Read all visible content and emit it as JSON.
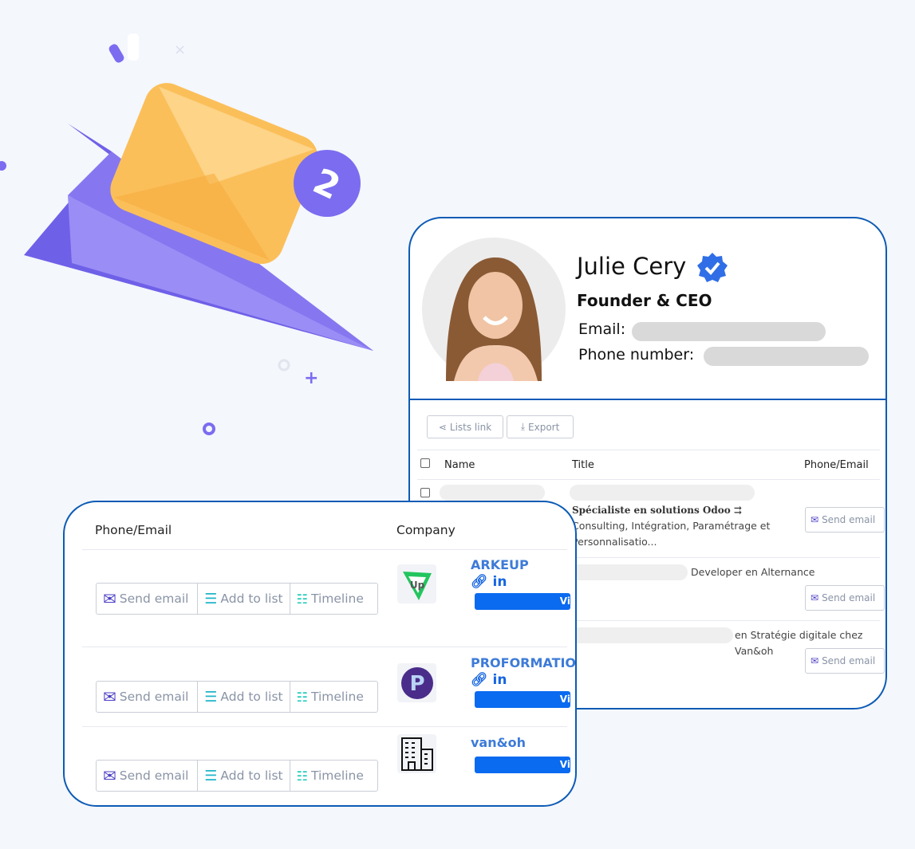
{
  "profile": {
    "name": "Julie Cery",
    "title": "Founder & CEO",
    "email_label": "Email:",
    "phone_label": "Phone number:",
    "verified_icon": "verified-badge-icon"
  },
  "toolbar": {
    "lists_link": "Lists link",
    "export": "Export"
  },
  "table": {
    "headers": [
      "Name",
      "Title",
      "Phone/Email"
    ],
    "rows": [
      {
        "title_bold": "Spécialiste en solutions Odoo ⇉",
        "title_rest": "Consulting, Intégration, Paramétrage et Personnalisatio...",
        "action": "Send email"
      },
      {
        "title_bold": "",
        "title_rest": "Developer en Alternance",
        "action": "Send email"
      },
      {
        "title_bold": "",
        "title_rest": "en Stratégie digitale chez Van&oh",
        "action": "Send email"
      }
    ]
  },
  "overlay": {
    "headers": [
      "Phone/Email",
      "Company"
    ],
    "actions": {
      "send": "Send email",
      "add": "Add to list",
      "timeline": "Timeline"
    },
    "companies": [
      {
        "name": "ARKEUP",
        "linkedin": "in",
        "view": "Vi"
      },
      {
        "name": "PROFORMATIO",
        "linkedin": "in",
        "view": "Vi"
      },
      {
        "name": "van&oh",
        "view": "Vi"
      }
    ]
  },
  "colors": {
    "border": "#0d5bb5",
    "link": "#3d7bd8",
    "button": "#0a6af0",
    "illustration_purple": "#7b6cf0",
    "envelope": "#fbbf5a"
  }
}
